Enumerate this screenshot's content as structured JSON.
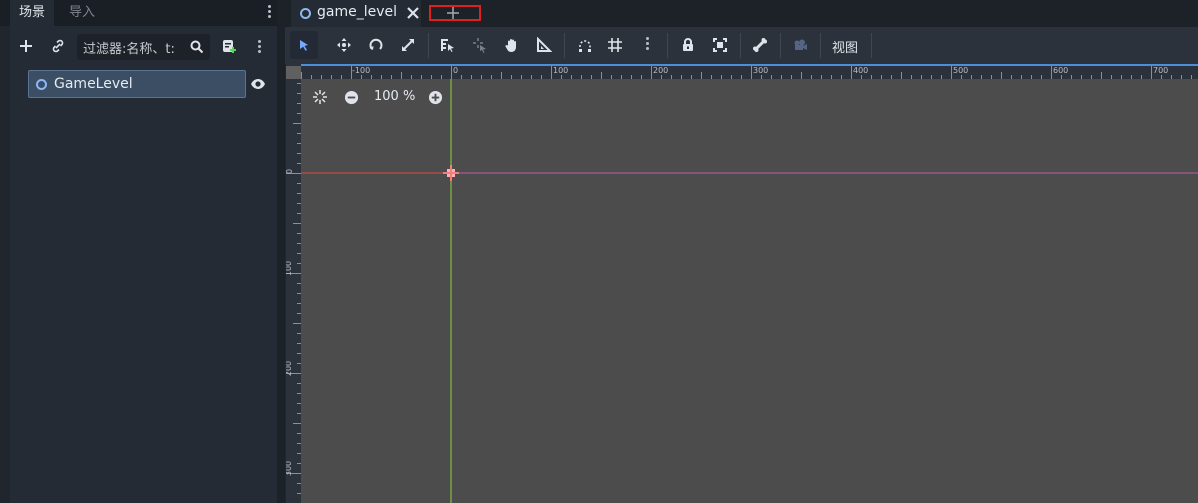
{
  "left_dock": {
    "tabs": [
      {
        "label": "场景",
        "active": true
      },
      {
        "label": "导入",
        "active": false
      }
    ],
    "toolbar": {
      "add_icon": "plus-icon",
      "link_icon": "link-icon",
      "filter_placeholder": "过滤器:名称、t:",
      "search_icon": "search-icon",
      "script_icon": "attach-script-icon",
      "menu_icon": "more-vertical-icon"
    },
    "tree": {
      "root": {
        "label": "GameLevel",
        "type_icon": "node2d-circle-icon",
        "visibility_icon": "eye-icon"
      }
    }
  },
  "main": {
    "scene_tabs": [
      {
        "label": "game_level",
        "icon": "node2d-circle-icon",
        "close_icon": "close-icon"
      }
    ],
    "add_tab_icon": "plus-icon",
    "toolbar": {
      "tools": [
        "select-icon",
        "move-icon",
        "rotate-icon",
        "scale-icon",
        "list-select-icon",
        "pivot-icon",
        "pan-icon",
        "ruler-icon",
        "smart-snap-icon",
        "grid-snap-icon",
        "more-vertical-icon",
        "lock-icon",
        "group-icon",
        "bone-icon",
        "camera-icon"
      ],
      "view_label": "视图"
    },
    "viewport": {
      "zoom_text": "100 %",
      "center_icon": "center-view-icon",
      "zoom_out_icon": "zoom-out-icon",
      "zoom_in_icon": "zoom-in-icon",
      "ruler_top": [
        "-100",
        "0",
        "100",
        "200",
        "300",
        "400",
        "500",
        "600",
        "700"
      ],
      "ruler_left": [
        "0",
        "100",
        "200",
        "300"
      ],
      "accent_color": "#4a8fd8",
      "x_axis_color": "#e04848",
      "y_axis_color": "#8fd048"
    }
  }
}
